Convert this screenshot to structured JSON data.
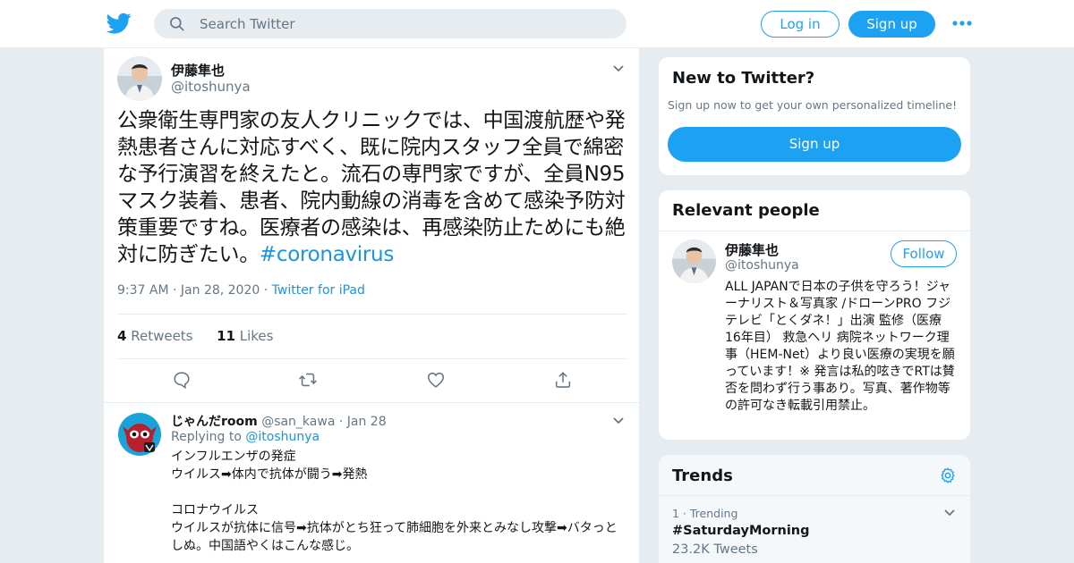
{
  "nav": {
    "search_placeholder": "Search Twitter",
    "login_label": "Log in",
    "signup_label": "Sign up",
    "more_icon": "more-dots-icon",
    "brand_color": "#1da1f2"
  },
  "tweet": {
    "author_name": "伊藤隼也",
    "author_handle": "@itoshunya",
    "text": "公衆衛生専門家の友人クリニックでは、中国渡航歴や発熱患者さんに対応すべく、既に院内スタッフ全員で綿密な予行演習を終えたと。流石の専門家ですが、全員N95マスク装着、患者、院内動線の消毒を含めて感染予防対策重要ですね。医療者の感染は、再感染防止ためにも絶対に防ぎたい。",
    "hashtag": "#coronavirus",
    "time": "9:37 AM",
    "date": "Jan 28, 2020",
    "source": "Twitter for iPad",
    "retweets_count": "4",
    "retweets_label": "Retweets",
    "likes_count": "11",
    "likes_label": "Likes"
  },
  "reply": {
    "name": "じゃんだroom",
    "handle": "@san_kawa",
    "date": "Jan 28",
    "replying_prefix": "Replying to",
    "replying_to": "@itoshunya",
    "text": "インフルエンザの発症\nウイルス➡体内で抗体が闘う➡発熱\n\nコロナウイルス\nウイルスが抗体に信号➡抗体がとち狂って肺細胞を外来とみなし攻撃➡バタっとしぬ。中国語やくはこんな感じ。"
  },
  "sidebar": {
    "new_title": "New to Twitter?",
    "new_sub": "Sign up now to get your own personalized timeline!",
    "new_button": "Sign up",
    "relevant_title": "Relevant people",
    "person_name": "伊藤隼也",
    "person_handle": "@itoshunya",
    "follow_label": "Follow",
    "person_bio": "ALL JAPANで日本の子供を守ろう！ジャーナリスト＆写真家 /ドローンPRO フジテレビ「とくダネ！」出演 監修（医療 16年目） 救急ヘリ 病院ネットワーク理事（HEM-Net）より良い医療の実現を願っています！※ 発言は私的呟きでRTは賛否を問わず行う事あり。写真、著作物等の許可なき転載引用禁止。",
    "trends_title": "Trends",
    "trend_rank": "1 · Trending",
    "trend_tag": "#SaturdayMorning",
    "trend_count": "23.2K Tweets"
  }
}
